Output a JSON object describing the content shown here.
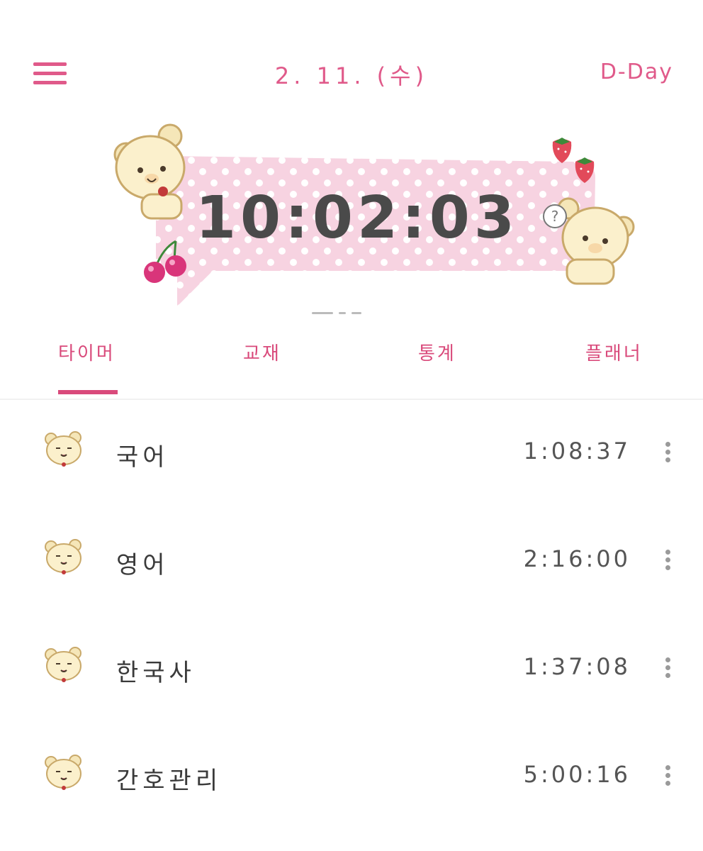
{
  "header": {
    "date": "2. 11. (수)",
    "dday_label": "D-Day",
    "menu_icon": "hamburger-menu-icon"
  },
  "banner": {
    "total_time": "10:02:03",
    "help_symbol": "?"
  },
  "tabs": [
    {
      "label": "타이머",
      "active": true
    },
    {
      "label": "교재",
      "active": false
    },
    {
      "label": "통계",
      "active": false
    },
    {
      "label": "플래너",
      "active": false
    }
  ],
  "subjects": [
    {
      "name": "국어",
      "time": "1:08:37"
    },
    {
      "name": "영어",
      "time": "2:16:00"
    },
    {
      "name": "한국사",
      "time": "1:37:08"
    },
    {
      "name": "간호관리",
      "time": "5:00:16"
    }
  ],
  "colors": {
    "accent": "#e05a8a",
    "tab_accent": "#d94a7b",
    "bubble_pink": "#f7d3e1",
    "text_dark": "#4a4a4a"
  }
}
